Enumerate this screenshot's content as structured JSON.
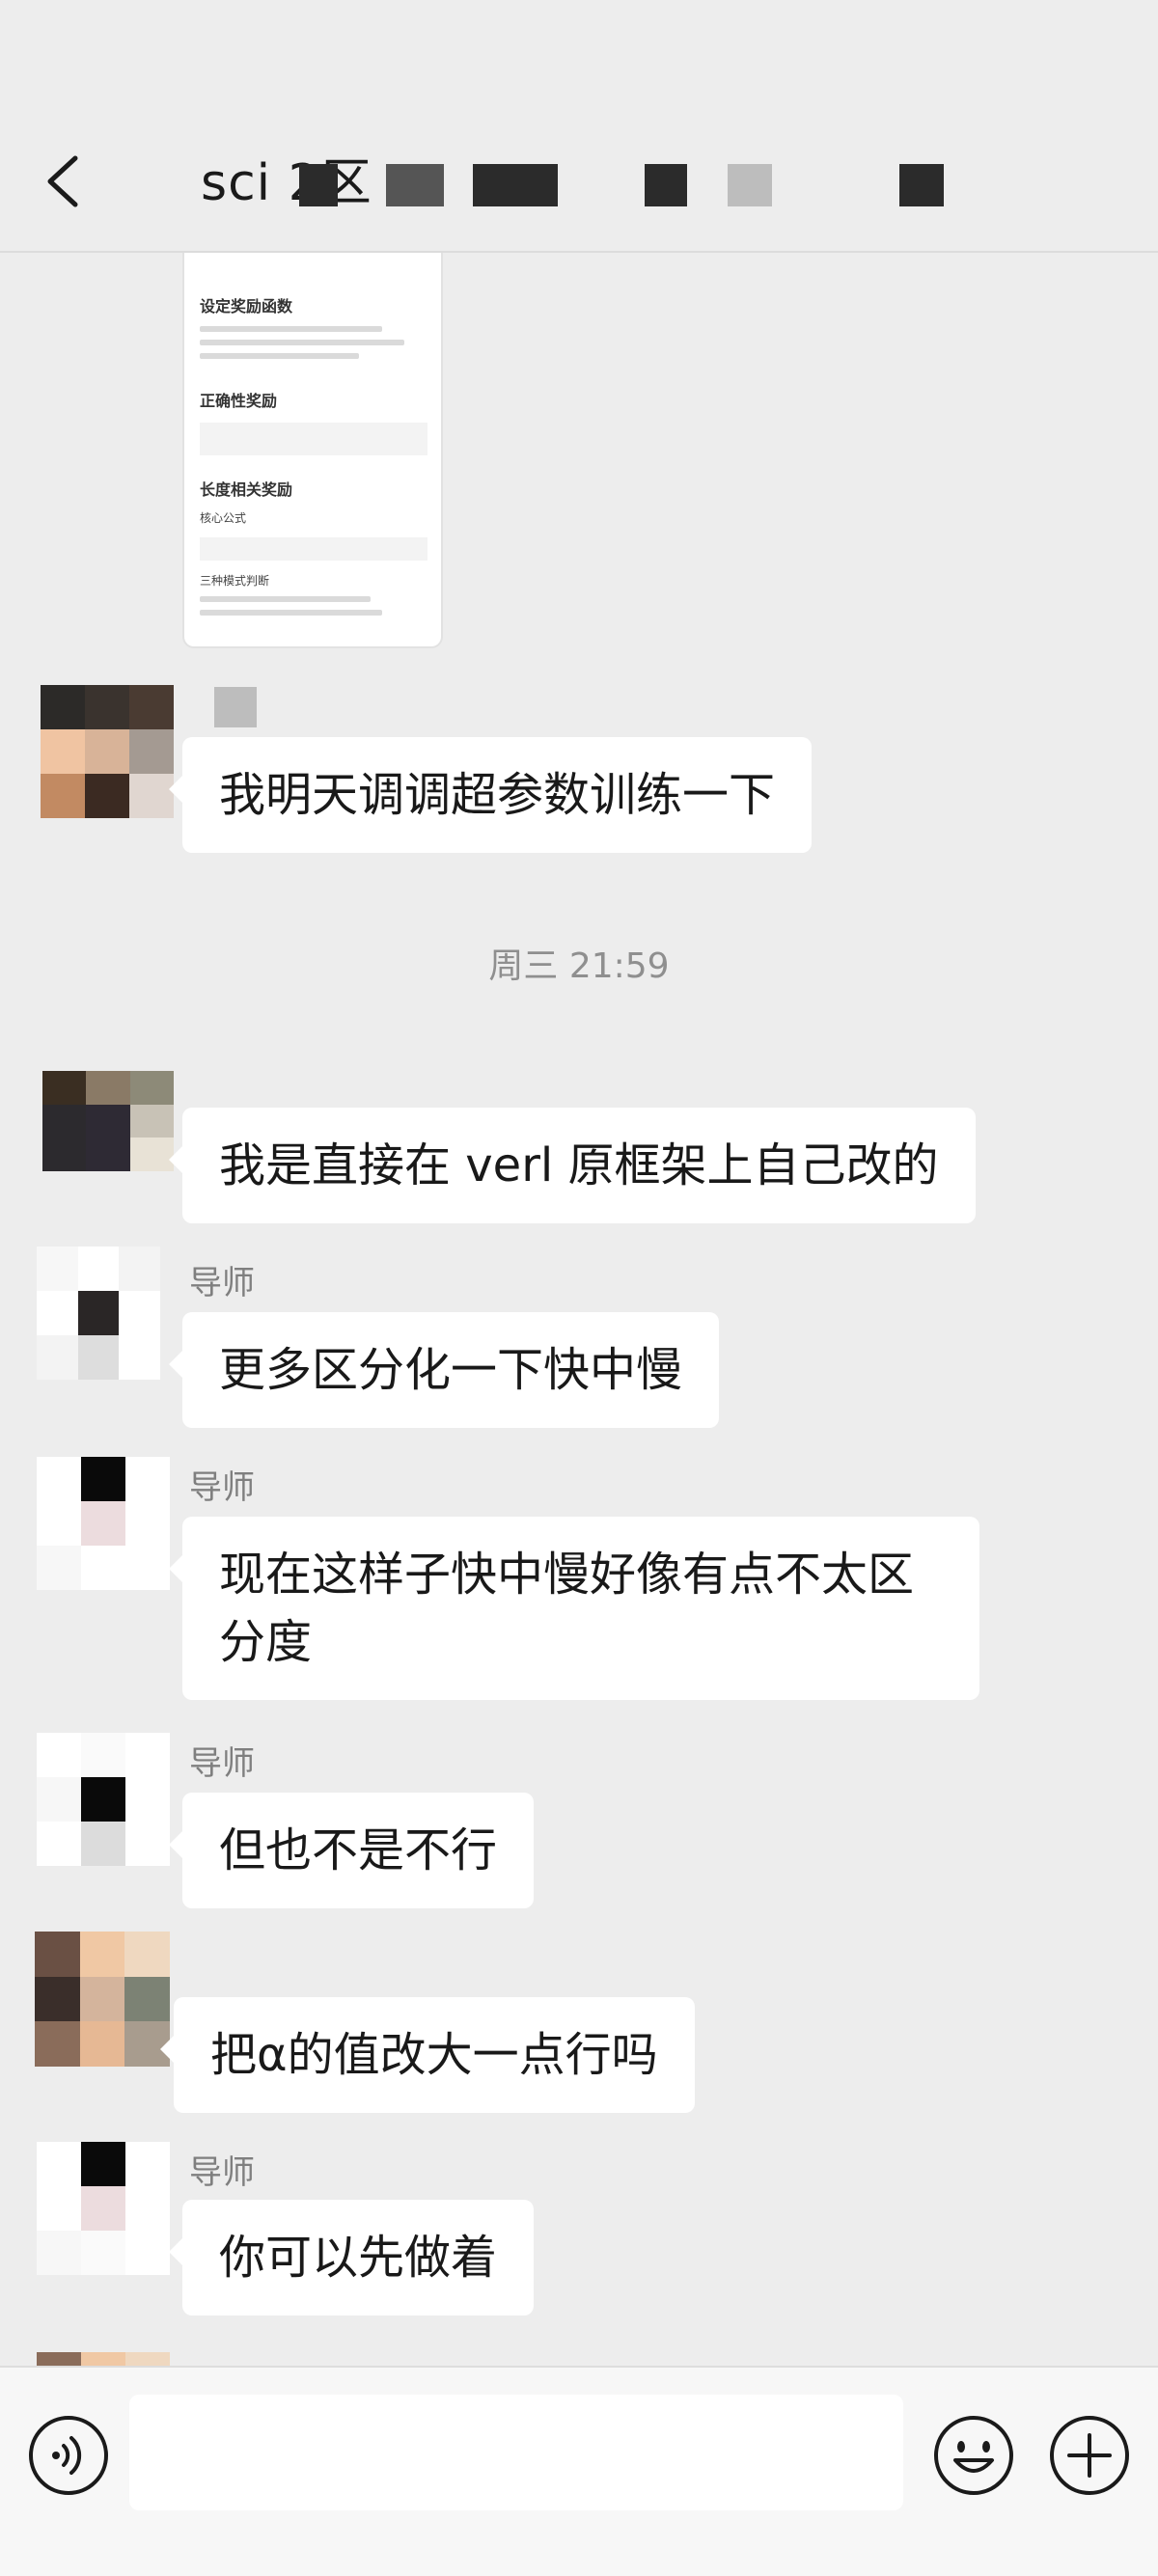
{
  "header": {
    "back_icon": "chevron-left-icon",
    "title": "sci 2区"
  },
  "chat": {
    "shared_image": {
      "heading_1": "设定奖励函数",
      "heading_2": "正确性奖励",
      "heading_3": "长度相关奖励",
      "sub_1": "核心公式",
      "sub_2": "三种模式判断"
    },
    "timestamp": "周三 21:59",
    "messages": [
      {
        "sender": "",
        "text": "我明天调调超参数训练一下"
      },
      {
        "sender": "",
        "text": "我是直接在 verl 原框架上自己改的"
      },
      {
        "sender": "导师",
        "text": "更多区分化一下快中慢"
      },
      {
        "sender": "导师",
        "text": "现在这样子快中慢好像有点不太区分度"
      },
      {
        "sender": "导师",
        "text": "但也不是不行"
      },
      {
        "sender": "",
        "text": "把α的值改大一点行吗"
      },
      {
        "sender": "导师",
        "text": "你可以先做着"
      }
    ]
  },
  "input_bar": {
    "voice_icon": "voice-icon",
    "input_value": "",
    "emoji_icon": "emoji-icon",
    "plus_icon": "plus-icon"
  },
  "colors": {
    "background": "#ededed",
    "bubble": "#ffffff",
    "text": "#191919",
    "secondary_text": "#8f8f8f"
  }
}
